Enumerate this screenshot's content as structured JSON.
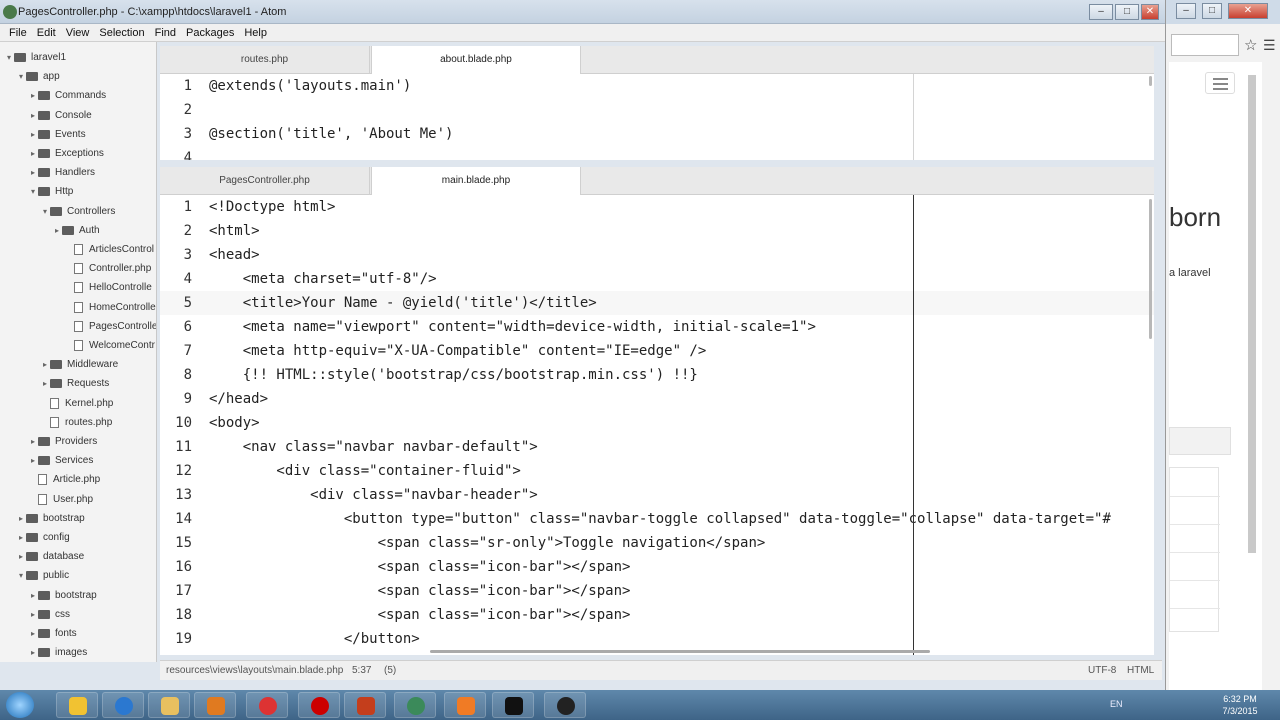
{
  "window": {
    "title": "PagesController.php - C:\\xampp\\htdocs\\laravel1 - Atom",
    "minimize": "–",
    "maximize": "□",
    "close": "✕"
  },
  "menu": [
    "File",
    "Edit",
    "View",
    "Selection",
    "Find",
    "Packages",
    "Help"
  ],
  "tree": [
    {
      "label": "laravel1",
      "type": "folder",
      "expanded": true
    },
    {
      "label": "app",
      "type": "folder",
      "expanded": true
    },
    {
      "label": "Commands",
      "type": "folder",
      "expanded": false
    },
    {
      "label": "Console",
      "type": "folder",
      "expanded": false
    },
    {
      "label": "Events",
      "type": "folder",
      "expanded": false
    },
    {
      "label": "Exceptions",
      "type": "folder",
      "expanded": false
    },
    {
      "label": "Handlers",
      "type": "folder",
      "expanded": false
    },
    {
      "label": "Http",
      "type": "folder",
      "expanded": true
    },
    {
      "label": "Controllers",
      "type": "folder",
      "expanded": true
    },
    {
      "label": "Auth",
      "type": "folder",
      "expanded": false
    },
    {
      "label": "ArticlesControl",
      "type": "file"
    },
    {
      "label": "Controller.php",
      "type": "file"
    },
    {
      "label": "HelloControlle",
      "type": "file"
    },
    {
      "label": "HomeControlle",
      "type": "file"
    },
    {
      "label": "PagesControlle",
      "type": "file"
    },
    {
      "label": "WelcomeContr",
      "type": "file"
    },
    {
      "label": "Middleware",
      "type": "folder",
      "expanded": false
    },
    {
      "label": "Requests",
      "type": "folder",
      "expanded": false
    },
    {
      "label": "Kernel.php",
      "type": "file"
    },
    {
      "label": "routes.php",
      "type": "file"
    },
    {
      "label": "Providers",
      "type": "folder",
      "expanded": false
    },
    {
      "label": "Services",
      "type": "folder",
      "expanded": false
    },
    {
      "label": "Article.php",
      "type": "file"
    },
    {
      "label": "User.php",
      "type": "file"
    },
    {
      "label": "bootstrap",
      "type": "folder",
      "expanded": false
    },
    {
      "label": "config",
      "type": "folder",
      "expanded": false
    },
    {
      "label": "database",
      "type": "folder",
      "expanded": false
    },
    {
      "label": "public",
      "type": "folder",
      "expanded": true
    },
    {
      "label": "bootstrap",
      "type": "folder",
      "expanded": false
    },
    {
      "label": "css",
      "type": "folder",
      "expanded": false
    },
    {
      "label": "fonts",
      "type": "folder",
      "expanded": false
    },
    {
      "label": "images",
      "type": "folder",
      "expanded": false
    }
  ],
  "top_pane": {
    "tabs": [
      {
        "label": "routes.php",
        "active": false
      },
      {
        "label": "about.blade.php",
        "active": true
      }
    ],
    "lines": [
      {
        "n": "1",
        "text": "@extends('layouts.main')"
      },
      {
        "n": "2",
        "text": ""
      },
      {
        "n": "3",
        "text": "@section('title', 'About Me')"
      },
      {
        "n": "4",
        "text": ""
      }
    ]
  },
  "bottom_pane": {
    "tabs": [
      {
        "label": "PagesController.php",
        "active": false
      },
      {
        "label": "main.blade.php",
        "active": true
      }
    ],
    "current_line": 5,
    "lines": [
      {
        "n": "1",
        "text": "<!Doctype html>"
      },
      {
        "n": "2",
        "text": "<html>"
      },
      {
        "n": "3",
        "text": "<head>"
      },
      {
        "n": "4",
        "text": "    <meta charset=\"utf-8\"/>"
      },
      {
        "n": "5",
        "text": "    <title>Your Name - @yield('title')</title>"
      },
      {
        "n": "6",
        "text": "    <meta name=\"viewport\" content=\"width=device-width, initial-scale=1\">"
      },
      {
        "n": "7",
        "text": "    <meta http-equiv=\"X-UA-Compatible\" content=\"IE=edge\" />"
      },
      {
        "n": "8",
        "text": "    {!! HTML::style('bootstrap/css/bootstrap.min.css') !!}"
      },
      {
        "n": "9",
        "text": "</head>"
      },
      {
        "n": "10",
        "text": "<body>"
      },
      {
        "n": "11",
        "text": "    <nav class=\"navbar navbar-default\">"
      },
      {
        "n": "12",
        "text": "        <div class=\"container-fluid\">"
      },
      {
        "n": "13",
        "text": "            <div class=\"navbar-header\">"
      },
      {
        "n": "14",
        "text": "                <button type=\"button\" class=\"navbar-toggle collapsed\" data-toggle=\"collapse\" data-target=\"#"
      },
      {
        "n": "15",
        "text": "                    <span class=\"sr-only\">Toggle navigation</span>"
      },
      {
        "n": "16",
        "text": "                    <span class=\"icon-bar\"></span>"
      },
      {
        "n": "17",
        "text": "                    <span class=\"icon-bar\"></span>"
      },
      {
        "n": "18",
        "text": "                    <span class=\"icon-bar\"></span>"
      },
      {
        "n": "19",
        "text": "                </button>"
      }
    ]
  },
  "status": {
    "path": "resources\\views\\layouts\\main.blade.php",
    "cursor": "5:37",
    "selection": "(5)",
    "encoding": "UTF-8",
    "grammar": "HTML"
  },
  "browser": {
    "brand_partial": "born",
    "text_partial": "a laravel",
    "icons": [
      "star-icon",
      "menu-icon"
    ]
  },
  "taskbar": {
    "tray_lang": "EN",
    "time": "6:32 PM",
    "date": "7/3/2015"
  },
  "colors": {
    "accent": "#4e7395",
    "editor_bg": "#ffffff",
    "tree_bg": "#f3f3f3"
  }
}
